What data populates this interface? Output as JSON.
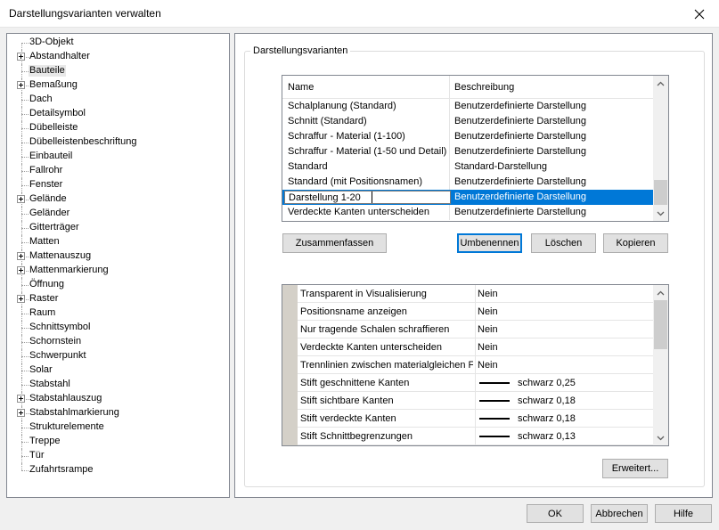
{
  "window": {
    "title": "Darstellungsvarianten verwalten"
  },
  "tree": {
    "items": [
      {
        "label": "3D-Objekt",
        "expandable": false
      },
      {
        "label": "Abstandhalter",
        "expandable": true
      },
      {
        "label": "Bauteile",
        "expandable": false,
        "selected": true
      },
      {
        "label": "Bemaßung",
        "expandable": true
      },
      {
        "label": "Dach",
        "expandable": false
      },
      {
        "label": "Detailsymbol",
        "expandable": false
      },
      {
        "label": "Dübelleiste",
        "expandable": false
      },
      {
        "label": "Dübelleistenbeschriftung",
        "expandable": false
      },
      {
        "label": "Einbauteil",
        "expandable": false
      },
      {
        "label": "Fallrohr",
        "expandable": false
      },
      {
        "label": "Fenster",
        "expandable": false
      },
      {
        "label": "Gelände",
        "expandable": true
      },
      {
        "label": "Geländer",
        "expandable": false
      },
      {
        "label": "Gitterträger",
        "expandable": false
      },
      {
        "label": "Matten",
        "expandable": false
      },
      {
        "label": "Mattenauszug",
        "expandable": true
      },
      {
        "label": "Mattenmarkierung",
        "expandable": true
      },
      {
        "label": "Öffnung",
        "expandable": false
      },
      {
        "label": "Raster",
        "expandable": true
      },
      {
        "label": "Raum",
        "expandable": false
      },
      {
        "label": "Schnittsymbol",
        "expandable": false
      },
      {
        "label": "Schornstein",
        "expandable": false
      },
      {
        "label": "Schwerpunkt",
        "expandable": false
      },
      {
        "label": "Solar",
        "expandable": false
      },
      {
        "label": "Stabstahl",
        "expandable": false
      },
      {
        "label": "Stabstahlauszug",
        "expandable": true
      },
      {
        "label": "Stabstahlmarkierung",
        "expandable": true
      },
      {
        "label": "Strukturelemente",
        "expandable": false
      },
      {
        "label": "Treppe",
        "expandable": false
      },
      {
        "label": "Tür",
        "expandable": false
      },
      {
        "label": "Zufahrtsrampe",
        "expandable": false
      }
    ]
  },
  "group": {
    "title": "Darstellungsvarianten"
  },
  "variants": {
    "headers": {
      "name": "Name",
      "description": "Beschreibung"
    },
    "rows": [
      {
        "name": "Schalplanung (Standard)",
        "description": "Benutzerdefinierte Darstellung"
      },
      {
        "name": "Schnitt (Standard)",
        "description": "Benutzerdefinierte Darstellung"
      },
      {
        "name": "Schraffur - Material (1-100)",
        "description": "Benutzerdefinierte Darstellung"
      },
      {
        "name": "Schraffur - Material (1-50 und Detail)",
        "description": "Benutzerdefinierte Darstellung"
      },
      {
        "name": "Standard",
        "description": "Standard-Darstellung"
      },
      {
        "name": "Standard (mit Positionsnamen)",
        "description": "Benutzerdefinierte Darstellung"
      },
      {
        "name": "Darstellung 1-20",
        "description": "Benutzerdefinierte Darstellung",
        "selected": true,
        "editing": true
      },
      {
        "name": "Verdeckte Kanten unterscheiden",
        "description": "Benutzerdefinierte Darstellung"
      }
    ],
    "edit_value": "Darstellung 1-20"
  },
  "buttons": {
    "merge": "Zusammenfassen",
    "rename": "Umbenennen",
    "delete": "Löschen",
    "copy": "Kopieren",
    "advanced": "Erweitert...",
    "ok": "OK",
    "cancel": "Abbrechen",
    "help": "Hilfe"
  },
  "properties": [
    {
      "key": "Transparent in Visualisierung",
      "value": "Nein",
      "pen": false
    },
    {
      "key": "Positionsname anzeigen",
      "value": "Nein",
      "pen": false
    },
    {
      "key": "Nur tragende Schalen schraffieren",
      "value": "Nein",
      "pen": false
    },
    {
      "key": "Verdeckte Kanten unterscheiden",
      "value": "Nein",
      "pen": false
    },
    {
      "key": "Trennlinien zwischen materialgleichen Flächen",
      "value": "Nein",
      "pen": false
    },
    {
      "key": "Stift geschnittene Kanten",
      "value": "schwarz 0,25",
      "pen": true
    },
    {
      "key": "Stift sichtbare Kanten",
      "value": "schwarz 0,18",
      "pen": true
    },
    {
      "key": "Stift verdeckte Kanten",
      "value": "schwarz 0,18",
      "pen": true
    },
    {
      "key": "Stift Schnittbegrenzungen",
      "value": "schwarz 0,13",
      "pen": true
    }
  ],
  "colors": {
    "selection": "#0078d7",
    "focus": "#0078d7",
    "gutter": "#d4d0c8"
  }
}
